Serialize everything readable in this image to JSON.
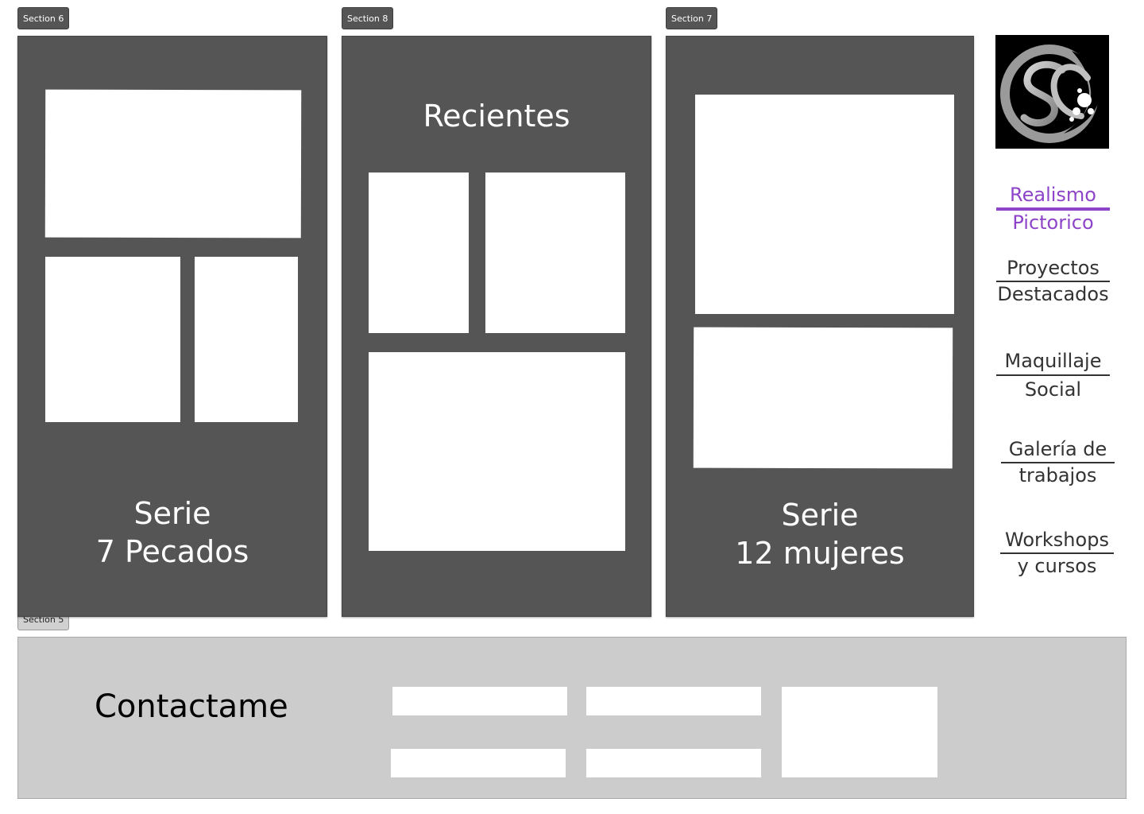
{
  "frames": {
    "section6": "Section 6",
    "section8": "Section 8",
    "section7": "Section 7",
    "section5": "Section 5"
  },
  "panels": {
    "siete_pecados": {
      "line1": "Serie",
      "line2": "7 Pecados"
    },
    "recientes": {
      "title": "Recientes"
    },
    "doce_mujeres": {
      "line1": "Serie",
      "line2": "12 mujeres"
    }
  },
  "logo": {
    "letters": "SC",
    "icon": "sc-monogram-logo"
  },
  "nav": {
    "items": [
      {
        "line1": "Realismo",
        "line2": "Pictorico",
        "active": true
      },
      {
        "line1": "Proyectos",
        "line2": "Destacados",
        "active": false
      },
      {
        "line1": "Maquillaje",
        "line2": "Social",
        "active": false
      },
      {
        "line1": "Galería de",
        "line2": "trabajos",
        "active": false
      },
      {
        "line1": "Workshops",
        "line2": "y cursos",
        "active": false
      }
    ]
  },
  "contact": {
    "title": "Contactame",
    "fields": {
      "field1": "",
      "field2": "",
      "field3": "",
      "field4": "",
      "message": ""
    }
  },
  "colors": {
    "panel": "#555555",
    "accent": "#8e44c8",
    "nav_text": "#333333",
    "contact_bg": "#cccccc"
  }
}
